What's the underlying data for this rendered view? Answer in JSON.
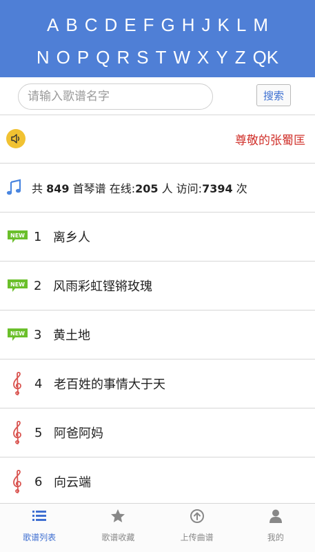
{
  "alphabet": {
    "row1": [
      "A",
      "B",
      "C",
      "D",
      "E",
      "F",
      "G",
      "H",
      "J",
      "K",
      "L",
      "M"
    ],
    "row2": [
      "N",
      "O",
      "P",
      "Q",
      "R",
      "S",
      "T",
      "W",
      "X",
      "Y",
      "Z",
      "QK"
    ]
  },
  "search": {
    "placeholder": "请输入歌谱名字",
    "button_label": "搜索"
  },
  "notice": {
    "icon": "speaker-icon",
    "text": "尊敬的张蜀匡"
  },
  "stats": {
    "icon": "music-note-icon",
    "prefix": "共",
    "total": "849",
    "unit_scores": "首琴谱 在线:",
    "online": "205",
    "unit_people": "人 访问:",
    "visits": "7394",
    "unit_times": "次"
  },
  "songs": [
    {
      "num": "1",
      "title": "离乡人",
      "icon": "new-badge-icon"
    },
    {
      "num": "2",
      "title": "风雨彩虹铿锵玫瑰",
      "icon": "new-badge-icon"
    },
    {
      "num": "3",
      "title": "黄土地",
      "icon": "new-badge-icon"
    },
    {
      "num": "4",
      "title": "老百姓的事情大于天",
      "icon": "treble-clef-icon"
    },
    {
      "num": "5",
      "title": "阿爸阿妈",
      "icon": "treble-clef-icon"
    },
    {
      "num": "6",
      "title": "向云端",
      "icon": "treble-clef-icon"
    }
  ],
  "tabs": [
    {
      "label": "歌谱列表",
      "icon": "list-icon",
      "active": true
    },
    {
      "label": "歌谱收藏",
      "icon": "star-icon",
      "active": false
    },
    {
      "label": "上传曲谱",
      "icon": "upload-icon",
      "active": false
    },
    {
      "label": "我的",
      "icon": "user-icon",
      "active": false
    }
  ],
  "colors": {
    "header_bg": "#4f7fd6",
    "accent": "#3f6fd1",
    "notice_text": "#d0302a",
    "new_badge": "#6abf2a",
    "clef": "#d9534f"
  }
}
